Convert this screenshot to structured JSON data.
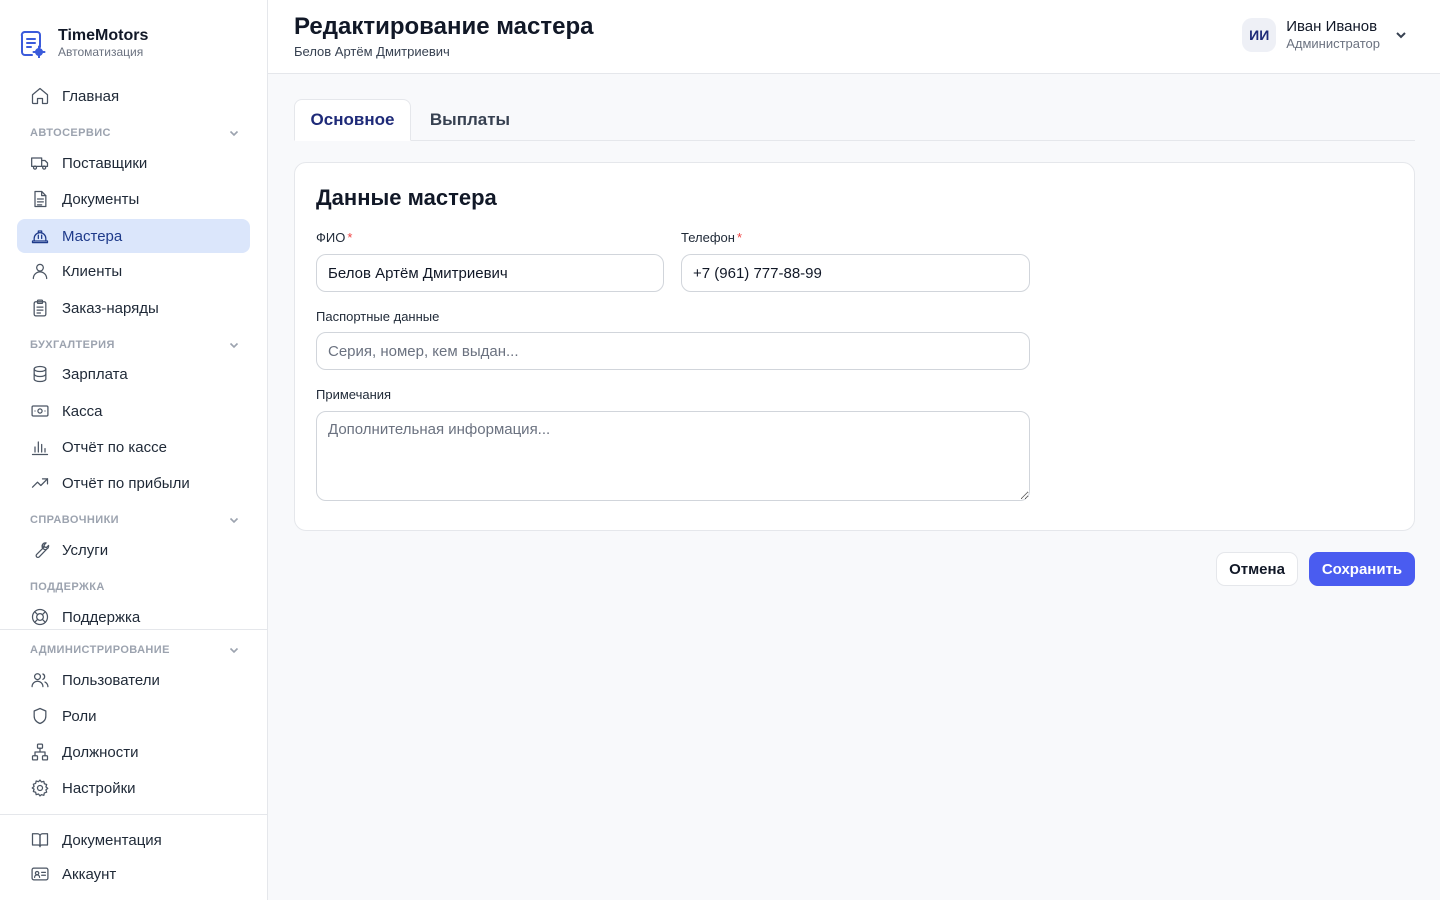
{
  "brand": {
    "name": "TimeMotors",
    "subtitle": "Автоматизация"
  },
  "nav": {
    "home": "Главная",
    "sections": {
      "autoservice": "АВТОСЕРВИС",
      "accounting": "БУХГАЛТЕРИЯ",
      "directories": "СПРАВОЧНИКИ",
      "support": "ПОДДЕРЖКА",
      "admin": "АДМИНИСТРИРОВАНИЕ"
    },
    "items": {
      "suppliers": "Поставщики",
      "documents": "Документы",
      "masters": "Мастера",
      "clients": "Клиенты",
      "orders": "Заказ-наряды",
      "salary": "Зарплата",
      "cash": "Касса",
      "cash_report": "Отчёт по кассе",
      "profit_report": "Отчёт по прибыли",
      "services": "Услуги",
      "support": "Поддержка",
      "users": "Пользователи",
      "roles": "Роли",
      "positions": "Должности",
      "settings": "Настройки",
      "documentation": "Документация",
      "account": "Аккаунт"
    },
    "active": "masters"
  },
  "header": {
    "title": "Редактирование мастера",
    "subtitle": "Белов Артём Дмитриевич"
  },
  "user": {
    "initials": "ИИ",
    "name": "Иван Иванов",
    "role": "Администратор"
  },
  "tabs": {
    "main": "Основное",
    "payments": "Выплаты",
    "active": "main"
  },
  "form": {
    "title": "Данные мастера",
    "fio": {
      "label": "ФИО",
      "required_mark": "*",
      "value": "Белов Артём Дмитриевич"
    },
    "phone": {
      "label": "Телефон",
      "required_mark": "*",
      "value": "+7 (961) 777-88-99"
    },
    "passport": {
      "label": "Паспортные данные",
      "value": "",
      "placeholder": "Серия, номер, кем выдан..."
    },
    "notes": {
      "label": "Примечания",
      "value": "",
      "placeholder": "Дополнительная информация..."
    }
  },
  "actions": {
    "cancel": "Отмена",
    "save": "Сохранить"
  },
  "colors": {
    "accent": "#4a5cf0",
    "active_nav_bg": "#dbe6fb",
    "required": "#ef4444"
  }
}
